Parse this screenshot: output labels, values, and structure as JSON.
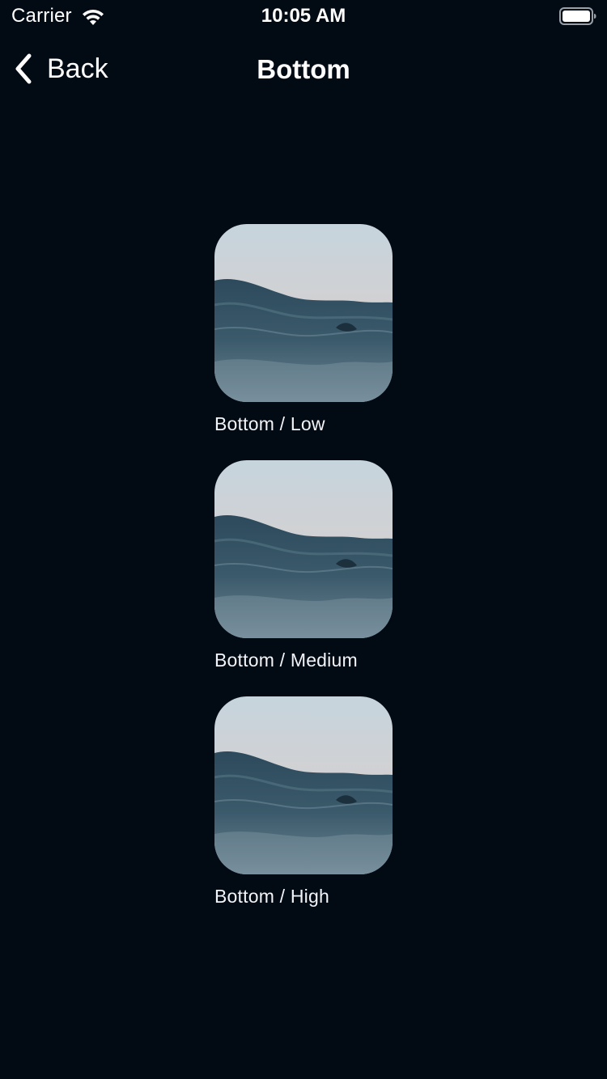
{
  "status_bar": {
    "carrier": "Carrier",
    "time": "10:05 AM",
    "wifi_icon": "wifi-icon",
    "battery_icon": "battery-icon"
  },
  "nav": {
    "back_label": "Back",
    "title": "Bottom"
  },
  "items": [
    {
      "label": "Bottom / Low",
      "image": "ocean-wave-image"
    },
    {
      "label": "Bottom / Medium",
      "image": "ocean-wave-image"
    },
    {
      "label": "Bottom / High",
      "image": "ocean-wave-image"
    }
  ],
  "colors": {
    "background": "#020a14",
    "text": "#ffffff",
    "sky_top": "#c9d6df",
    "sky_horizon": "#d8c9c4",
    "water_dark": "#1f3a4b"
  }
}
